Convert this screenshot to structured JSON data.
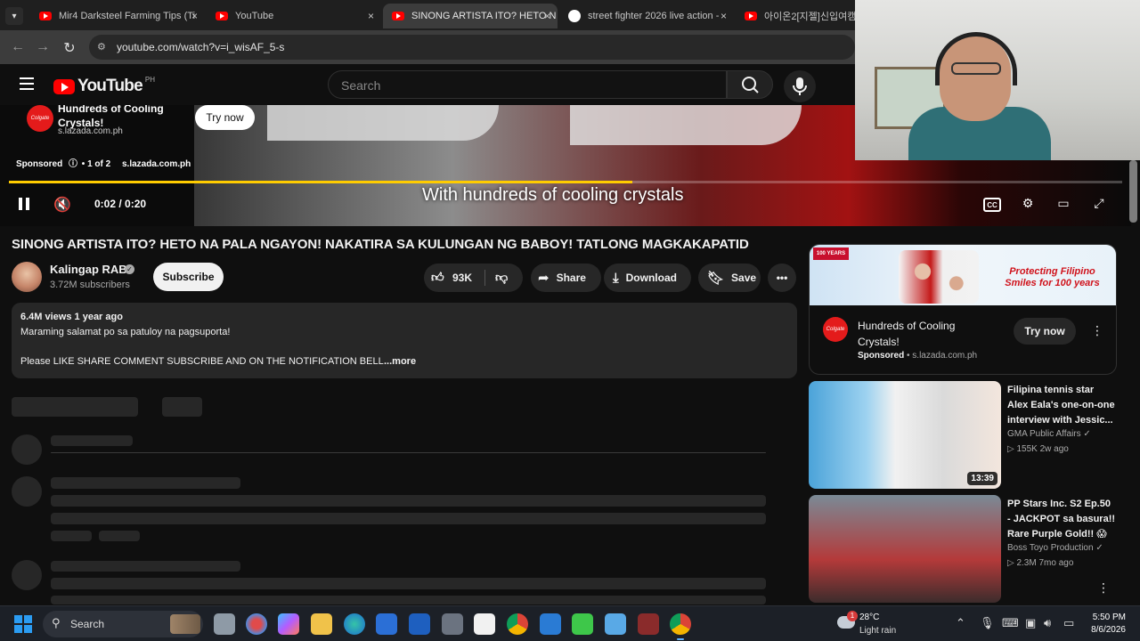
{
  "browser": {
    "tabs": [
      {
        "title": "Mir4 Darksteel Farming Tips (Ti",
        "icon": "youtube-icon",
        "active": false
      },
      {
        "title": "YouTube",
        "icon": "youtube-icon",
        "active": false
      },
      {
        "title": "SINONG ARTISTA ITO? HETO N",
        "icon": "youtube-icon",
        "active": true
      },
      {
        "title": "street fighter 2026 live action -",
        "icon": "google-icon",
        "active": false
      },
      {
        "title": "아이온2[지젤]신입여캠 l",
        "icon": "youtube-icon",
        "active": false
      }
    ],
    "tab_close": "×",
    "url": "youtube.com/watch?v=i_wisAF_5-s"
  },
  "youtube": {
    "logo_text": "YouTube",
    "country_code": "PH",
    "search_placeholder": "Search"
  },
  "player": {
    "ad": {
      "title": "Hundreds of Cooling Crystals!",
      "domain": "s.lazada.com.ph",
      "cta": "Try now",
      "sponsored_label": "Sponsored",
      "ad_counter": "• 1 of 2",
      "sponsor_domain": "s.lazada.com.ph",
      "logo_text": "Colgate"
    },
    "caption": "With hundreds of cooling crystals",
    "time": "0:02 / 0:20",
    "progress_fraction": 0.56,
    "cc_label": "CC"
  },
  "video": {
    "title": "SINONG ARTISTA ITO? HETO NA PALA NGAYON! NAKATIRA SA KULUNGAN NG BABOY! TATLONG MAGKAKAPATID",
    "channel": {
      "name": "Kalingap RAB",
      "subscribers": "3.72M subscribers"
    },
    "subscribe_label": "Subscribe",
    "likes": "93K",
    "share_label": "Share",
    "download_label": "Download",
    "save_label": "Save",
    "description": {
      "meta": "6.4M views  1 year ago",
      "line1": "Maraming salamat po sa patuloy na pagsuporta!",
      "line2": "Please LIKE SHARE COMMENT SUBSCRIBE AND ON THE NOTIFICATION BELL",
      "more_label": "...more"
    }
  },
  "sidebar": {
    "ad_card": {
      "banner_badge": "100 YEARS",
      "banner_text": "Protecting Filipino Smiles for 100 years",
      "title": "Hundreds of Cooling Crystals!",
      "sponsored": "Sponsored",
      "domain": "• s.lazada.com.ph",
      "cta": "Try now",
      "logo_text": "Colgate"
    },
    "recommendations": [
      {
        "title": "Filipina tennis star Alex Eala's one-on-one interview with Jessic...",
        "channel": "GMA Public Affairs",
        "meta": "155K  2w ago",
        "duration": "13:39"
      },
      {
        "title": "PP Stars Inc. S2 Ep.50 - JACKPOT sa basura!! Rare Purple Gold!! 😱",
        "channel": "Boss Toyo Production",
        "meta": "2.3M  7mo ago",
        "duration": ""
      }
    ]
  },
  "taskbar": {
    "search_label": "Search",
    "weather": {
      "badge": "1",
      "temp": "28°C",
      "condition": "Light rain"
    },
    "time": "5:50 PM",
    "date": "8/6/2026"
  },
  "colors": {
    "background": "#0f0f0f",
    "accent_red": "#ff0000",
    "progress": "#ffcc00",
    "chip": "#272727"
  }
}
